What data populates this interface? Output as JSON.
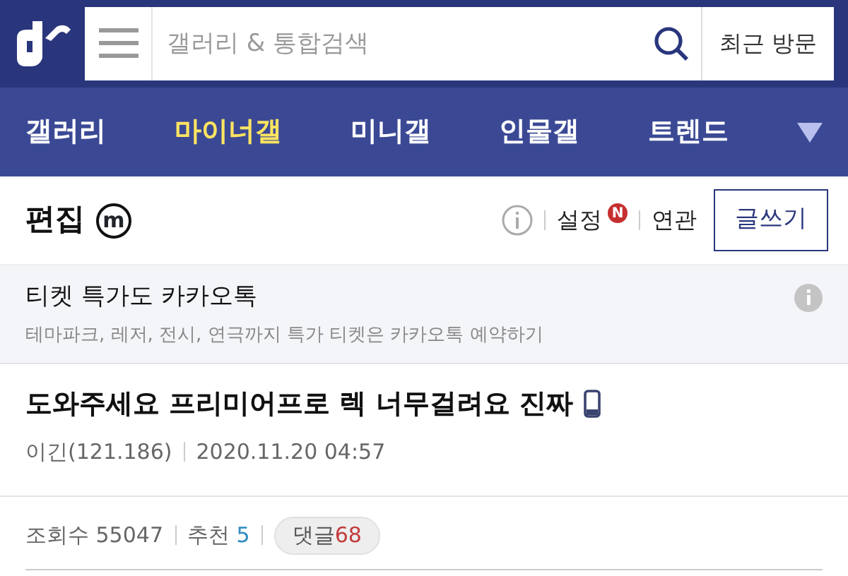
{
  "header": {
    "search": {
      "placeholder": "갤러리 & 통합검색"
    },
    "recent": "최근 방문"
  },
  "tabs": [
    {
      "label": "갤러리",
      "selected": false
    },
    {
      "label": "마이너갤",
      "selected": true
    },
    {
      "label": "미니갤",
      "selected": false
    },
    {
      "label": "인물갤",
      "selected": false
    },
    {
      "label": "트렌드",
      "selected": false
    }
  ],
  "gallery": {
    "name": "편집",
    "mark": "m",
    "settings": "설정",
    "settings_badge": "N",
    "related": "연관",
    "write": "글쓰기"
  },
  "ad": {
    "title": "티켓 특가도 카카오톡",
    "text": "테마파크, 레저, 전시, 연극까지 특가 티켓은 카카오톡 예약하기"
  },
  "post": {
    "title": "도와주세요 프리미어프로 렉 너무걸려요 진짜",
    "author": "이긴(121.186)",
    "date": "2020.11.20 04:57",
    "views_label": "조회수",
    "views": "55047",
    "likes_label": "추천",
    "likes": "5",
    "comments_label": "댓글",
    "comments": "68"
  }
}
